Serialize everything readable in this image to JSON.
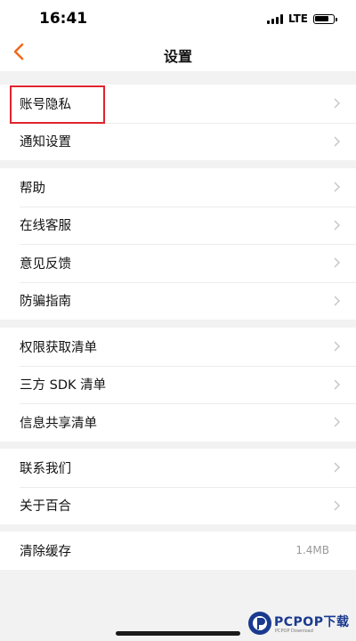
{
  "status_bar": {
    "time": "16:41",
    "network": "LTE"
  },
  "nav": {
    "title": "设置",
    "back_icon": "chevron-left-icon"
  },
  "colors": {
    "accent": "#f06a1d",
    "highlight": "#e0242c",
    "background": "#f2f2f2"
  },
  "groups": [
    {
      "items": [
        {
          "label": "账号隐私"
        },
        {
          "label": "通知设置"
        }
      ]
    },
    {
      "items": [
        {
          "label": "帮助"
        },
        {
          "label": "在线客服"
        },
        {
          "label": "意见反馈"
        },
        {
          "label": "防骗指南"
        }
      ]
    },
    {
      "items": [
        {
          "label": "权限获取清单"
        },
        {
          "label": "三方 SDK 清单"
        },
        {
          "label": "信息共享清单"
        }
      ]
    },
    {
      "items": [
        {
          "label": "联系我们"
        },
        {
          "label": "关于百合"
        }
      ]
    },
    {
      "items": [
        {
          "label": "清除缓存",
          "value": "1.4MB"
        }
      ]
    }
  ],
  "watermark": {
    "brand": "PCPOP下载",
    "sub": "PCPOP Download"
  }
}
